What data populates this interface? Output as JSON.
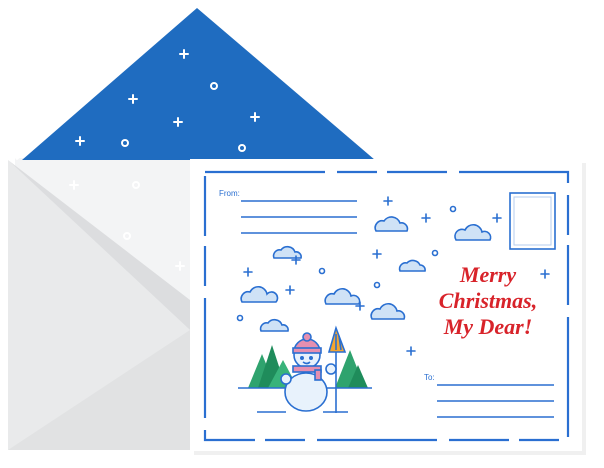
{
  "card": {
    "from_label": "From:",
    "to_label": "To:",
    "greeting": [
      "Merry",
      "Christmas,",
      "My Dear!"
    ]
  },
  "colors": {
    "envelope_liner": "#1f6cc0",
    "envelope_body": "#e9eaeb",
    "card_line": "#2a6fd1",
    "greeting": "#d8232a",
    "tree": "#29a06b",
    "hat": "#e58fb0"
  },
  "icons": [
    "envelope",
    "postcard",
    "snowman-icon",
    "broom-icon",
    "pine-tree-icon",
    "cloud-icon",
    "snowflake-icon",
    "stamp-box"
  ]
}
